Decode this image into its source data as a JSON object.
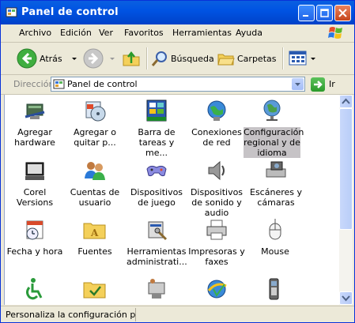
{
  "window": {
    "title": "Panel de control"
  },
  "menu": [
    "Archivo",
    "Edición",
    "Ver",
    "Favoritos",
    "Herramientas",
    "Ayuda"
  ],
  "toolbar": {
    "back_label": "Atrás",
    "search_label": "Búsqueda",
    "folders_label": "Carpetas"
  },
  "address": {
    "label": "Dirección",
    "value": "Panel de control",
    "go_label": "Ir"
  },
  "items": [
    {
      "label": "Agregar hardware",
      "icon": "hardware-icon"
    },
    {
      "label": "Agregar o quitar p...",
      "icon": "add-remove-programs-icon"
    },
    {
      "label": "Barra de tareas y me...",
      "icon": "taskbar-icon"
    },
    {
      "label": "Conexiones de red",
      "icon": "network-connections-icon"
    },
    {
      "label": "Configuración regional y de idioma",
      "icon": "regional-settings-icon"
    },
    {
      "label": "Corel Versions",
      "icon": "corel-versions-icon"
    },
    {
      "label": "Cuentas de usuario",
      "icon": "user-accounts-icon"
    },
    {
      "label": "Dispositivos de juego",
      "icon": "game-controllers-icon"
    },
    {
      "label": "Dispositivos de sonido y audio",
      "icon": "sound-devices-icon"
    },
    {
      "label": "Escáneres y cámaras",
      "icon": "scanners-cameras-icon"
    },
    {
      "label": "Fecha y hora",
      "icon": "date-time-icon"
    },
    {
      "label": "Fuentes",
      "icon": "fonts-folder-icon"
    },
    {
      "label": "Herramientas administrati...",
      "icon": "admin-tools-icon"
    },
    {
      "label": "Impresoras y faxes",
      "icon": "printers-faxes-icon"
    },
    {
      "label": "Mouse",
      "icon": "mouse-icon"
    }
  ],
  "status": {
    "text": "Personaliza la configuración para mostrar"
  }
}
